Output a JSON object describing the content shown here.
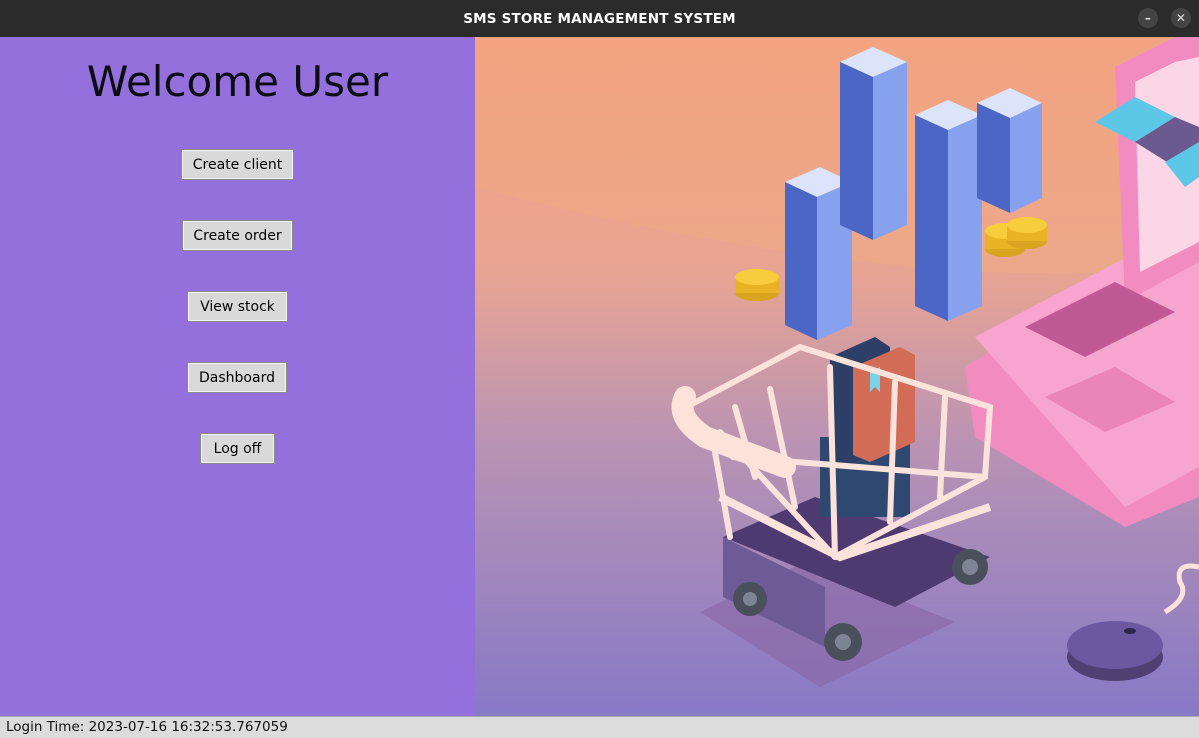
{
  "window": {
    "title": "SMS STORE MANAGEMENT SYSTEM",
    "minimize_glyph": "–",
    "close_glyph": "✕"
  },
  "left_panel": {
    "heading": "Welcome User",
    "background": "#9370db",
    "buttons": [
      {
        "label": "Create client"
      },
      {
        "label": "Create order"
      },
      {
        "label": "View stock"
      },
      {
        "label": "Dashboard"
      },
      {
        "label": "Log off"
      }
    ]
  },
  "illustration": {
    "description_icon": "shopping-cart-illustration"
  },
  "status_bar": {
    "text": "Login Time: 2023-07-16 16:32:53.767059"
  }
}
